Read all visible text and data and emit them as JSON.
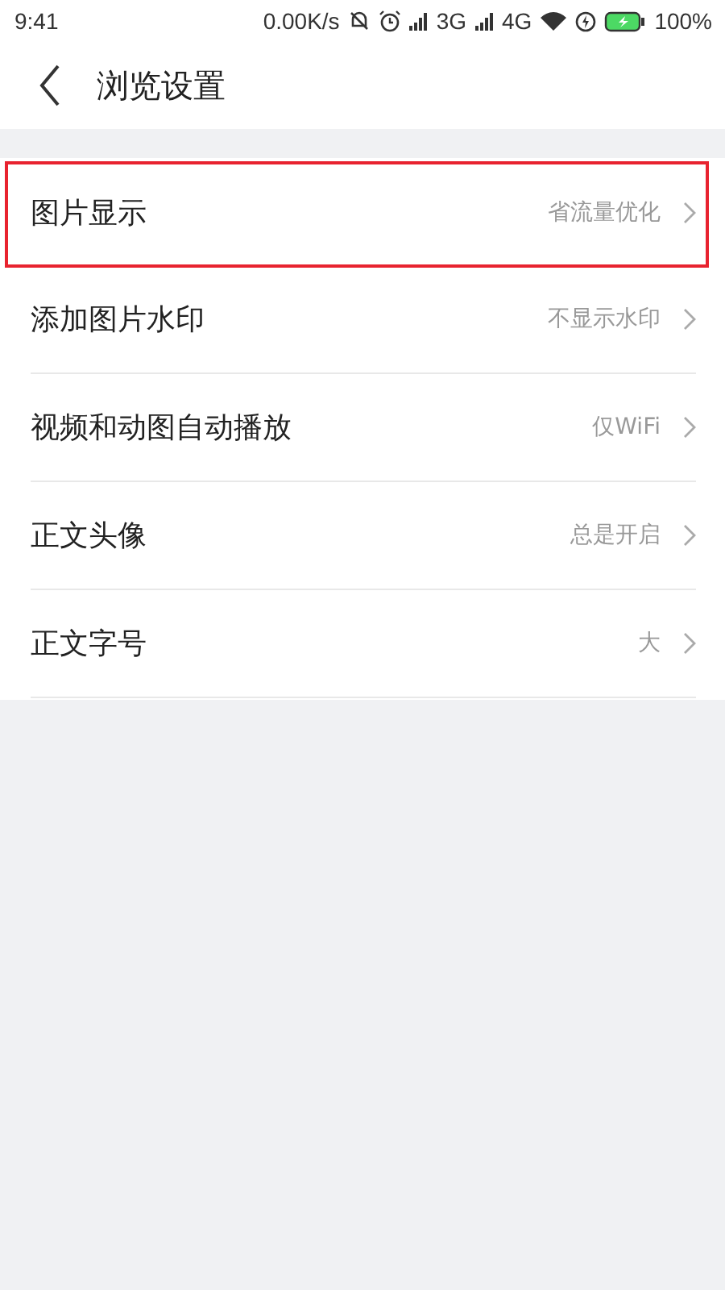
{
  "status_bar": {
    "time": "9:41",
    "speed": "0.00K/s",
    "network_1": "3G",
    "network_2": "4G",
    "battery": "100%"
  },
  "header": {
    "title": "浏览设置"
  },
  "settings": [
    {
      "label": "图片显示",
      "value": "省流量优化",
      "highlighted": true
    },
    {
      "label": "添加图片水印",
      "value": "不显示水印",
      "highlighted": false
    },
    {
      "label": "视频和动图自动播放",
      "value": "仅WiFi",
      "highlighted": false
    },
    {
      "label": "正文头像",
      "value": "总是开启",
      "highlighted": false
    },
    {
      "label": "正文字号",
      "value": "大",
      "highlighted": false
    }
  ]
}
